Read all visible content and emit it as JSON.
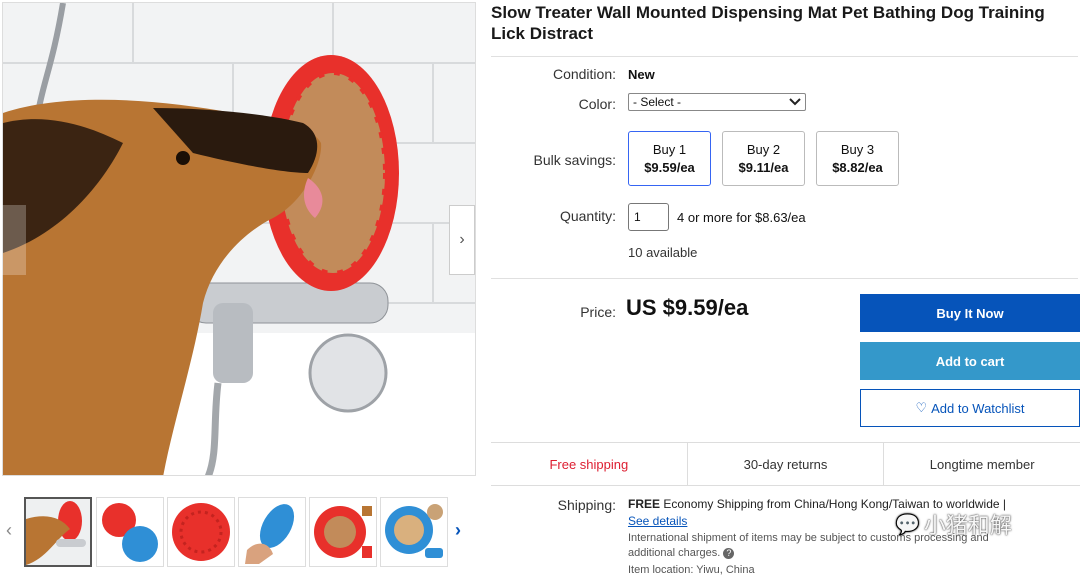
{
  "product": {
    "title": "Slow Treater Wall Mounted Dispensing Mat Pet Bathing Dog Training Lick Distract"
  },
  "details": {
    "condition_label": "Condition:",
    "condition_value": "New",
    "color_label": "Color:",
    "color_select": "- Select -",
    "bulk_label": "Bulk savings:",
    "bulk_options": [
      {
        "qty": "Buy 1",
        "price": "$9.59/ea"
      },
      {
        "qty": "Buy 2",
        "price": "$9.11/ea"
      },
      {
        "qty": "Buy 3",
        "price": "$8.82/ea"
      }
    ],
    "quantity_label": "Quantity:",
    "quantity_value": "1",
    "quantity_offer": "4 or more for $8.63/ea",
    "available": "10 available"
  },
  "pricing": {
    "price_label": "Price:",
    "price_value": "US $9.59/ea"
  },
  "actions": {
    "buy_now": "Buy It Now",
    "add_to_cart": "Add to cart",
    "watchlist": "Add to Watchlist"
  },
  "badges": [
    "Free shipping",
    "30-day returns",
    "Longtime member"
  ],
  "shipping": {
    "label": "Shipping:",
    "free": "FREE",
    "text": "Economy Shipping from China/Hong Kong/Taiwan to worldwide |",
    "see_details": "See details",
    "intl_note": "International shipment of items may be subject to customs processing and",
    "intl_note2": "additional charges.",
    "item_location": "Item location: Yiwu, China"
  },
  "watermark": "小猪和解",
  "colors": {
    "primary_blue": "#0654ba",
    "cart_blue": "#3498ca",
    "free_shipping_red": "#dd1e31",
    "mat_red": "#e8302b",
    "mat_blue": "#2f8fd6"
  }
}
